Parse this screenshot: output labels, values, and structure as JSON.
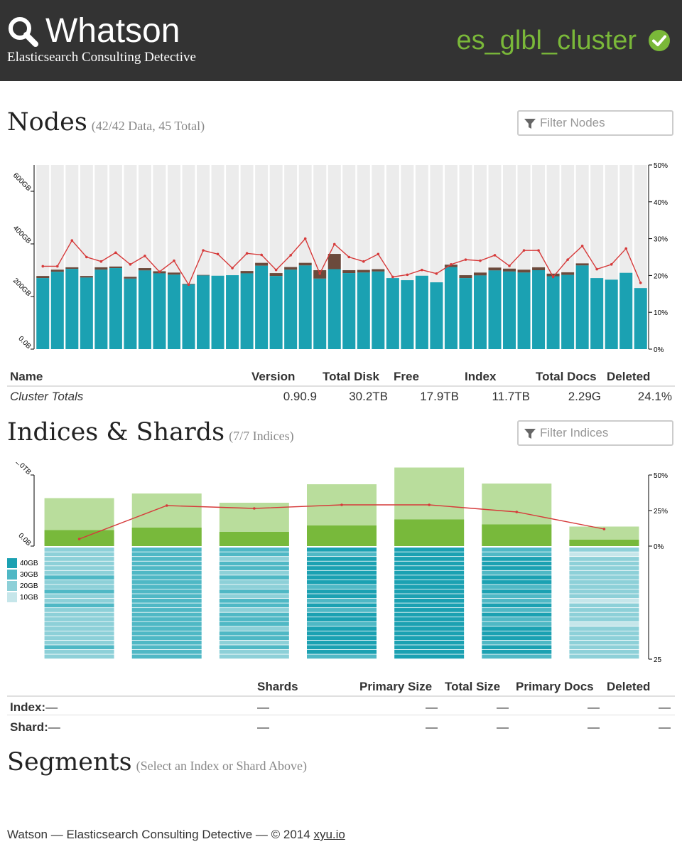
{
  "header": {
    "title": "Whatson",
    "subtitle": "Elasticsearch Consulting Detective",
    "cluster_name": "es_glbl_cluster",
    "cluster_status_icon": "check-circle-icon",
    "accent": "#7ab839"
  },
  "nodes": {
    "title": "Nodes",
    "summary": "(42/42 Data, 45 Total)",
    "filter_placeholder": "Filter Nodes"
  },
  "nodes_table": {
    "headers": [
      "Name",
      "Version",
      "Total Disk",
      "Free",
      "Index",
      "Total Docs",
      "Deleted"
    ],
    "totals": {
      "name": "Cluster Totals",
      "version": "0.90.9",
      "total_disk": "30.2TB",
      "free": "17.9TB",
      "index": "11.7TB",
      "total_docs": "2.29G",
      "deleted": "24.1%"
    }
  },
  "indices": {
    "title": "Indices & Shards",
    "summary": "(7/7 Indices)",
    "filter_placeholder": "Filter Indices"
  },
  "shards_table": {
    "headers": [
      "Shards",
      "Primary Size",
      "Total Size",
      "Primary Docs",
      "Deleted"
    ],
    "rows": [
      {
        "label": "Index:",
        "name": "—",
        "values": [
          "—",
          "—",
          "—",
          "—",
          "—"
        ]
      },
      {
        "label": "Shard:",
        "name": "—",
        "values": [
          "—",
          "—",
          "—",
          "—",
          "—"
        ]
      }
    ]
  },
  "segments": {
    "title": "Segments",
    "summary": "(Select an Index or Shard Above)"
  },
  "footer": {
    "text": "Watson — Elasticsearch Consulting Detective — © 2014",
    "link": "xyu.io"
  },
  "chart_data": [
    {
      "type": "bar",
      "left_axis_ticks": [
        "0.0B",
        "200GB",
        "400GB",
        "600GB"
      ],
      "right_axis_ticks": [
        "0%",
        "10%",
        "20%",
        "30%",
        "40%",
        "50%"
      ],
      "y_left_range": [
        0,
        700
      ],
      "y_right_range": [
        0,
        50
      ],
      "bar_colors": {
        "index": "#1ba1b2",
        "other": "#6b4a3c",
        "disk": "#ececec",
        "deleted_line": "#d63a3a"
      },
      "series": [
        {
          "name": "index",
          "values": [
            270,
            294,
            305,
            272,
            302,
            308,
            268,
            299,
            288,
            283,
            246,
            280,
            279,
            281,
            288,
            317,
            278,
            302,
            318,
            268,
            304,
            289,
            291,
            295,
            270,
            262,
            279,
            254,
            312,
            270,
            280,
            299,
            295,
            291,
            300,
            277,
            282,
            318,
            270,
            264,
            290,
            232
          ]
        },
        {
          "name": "other",
          "values": [
            8,
            8,
            6,
            6,
            9,
            6,
            7,
            9,
            8,
            8,
            2,
            2,
            0,
            0,
            9,
            11,
            11,
            10,
            10,
            32,
            58,
            11,
            10,
            9,
            0,
            0,
            0,
            0,
            9,
            11,
            11,
            11,
            11,
            11,
            11,
            10,
            10,
            8,
            0,
            0,
            0,
            0
          ]
        },
        {
          "name": "deleted",
          "values": [
            22.5,
            22.5,
            29.5,
            25,
            23.8,
            26.2,
            23,
            25.3,
            21,
            24,
            17.5,
            26.8,
            25.8,
            22,
            26,
            25.6,
            21.5,
            25.5,
            30,
            20.5,
            28.5,
            25,
            23.8,
            25.8,
            19.6,
            20.2,
            21.5,
            20.5,
            23,
            24.3,
            24,
            25.5,
            22.6,
            26.8,
            26.8,
            19.6,
            24.3,
            28,
            21.7,
            23,
            27.3,
            18
          ]
        }
      ]
    },
    {
      "type": "bar",
      "left_axis_ticks": [
        "0.0B",
        "2.0TB"
      ],
      "right_axis_ticks": [
        "0%",
        "25%",
        "50%"
      ],
      "right_axis_bottom_tick": "25",
      "y_left_range": [
        0,
        2.0
      ],
      "y_right_range": [
        0,
        50
      ],
      "legend": [
        "40GB",
        "30GB",
        "20GB",
        "10GB"
      ],
      "legend_colors": [
        "#1ba1b2",
        "#4fb8c5",
        "#8dd0d8",
        "#c6e6ea"
      ],
      "colors": {
        "total": "#b9dd9c",
        "primary": "#78b93b",
        "deleted_line": "#d63a3a"
      },
      "series": [
        {
          "name": "total",
          "values": [
            1.35,
            1.48,
            1.22,
            1.74,
            2.21,
            1.76,
            0.55
          ]
        },
        {
          "name": "primary",
          "values": [
            0.45,
            0.52,
            0.4,
            0.58,
            0.75,
            0.61,
            0.18
          ]
        },
        {
          "name": "deleted",
          "values": [
            5,
            28.5,
            26.5,
            29,
            29,
            24,
            12
          ]
        },
        {
          "name": "shard_level",
          "values": [
            1.2,
            1.8,
            1.4,
            2.5,
            3.2,
            2.4,
            0.6
          ]
        }
      ]
    }
  ]
}
